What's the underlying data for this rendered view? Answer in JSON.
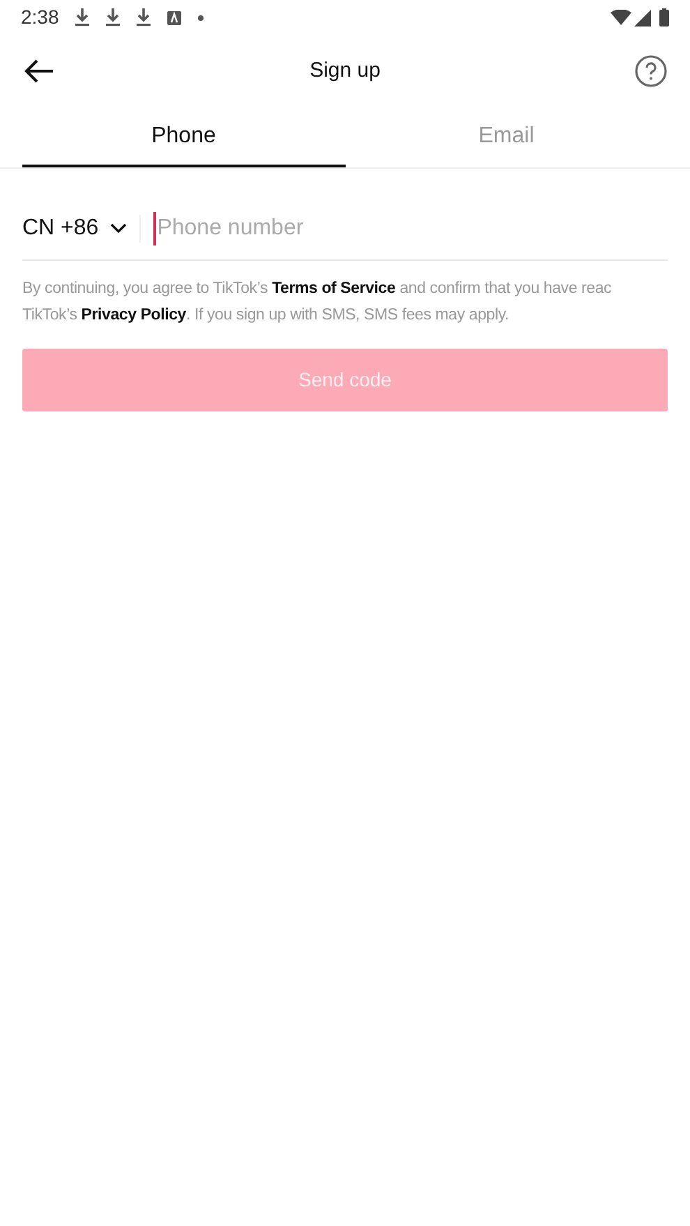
{
  "status_bar": {
    "time": "2:38"
  },
  "header": {
    "title": "Sign up"
  },
  "tabs": [
    {
      "label": "Phone",
      "selected": true
    },
    {
      "label": "Email",
      "selected": false
    }
  ],
  "phone": {
    "country_code": "CN +86",
    "placeholder": "Phone number"
  },
  "legal_lines": [
    "By continuing, you agree to TikTok’s **Terms of Service** and confirm that you have reac",
    "TikTok’s **Privacy Policy**. If you sign up with SMS, SMS fees may apply."
  ],
  "send_button": {
    "label": "Send code",
    "disabled": true
  }
}
